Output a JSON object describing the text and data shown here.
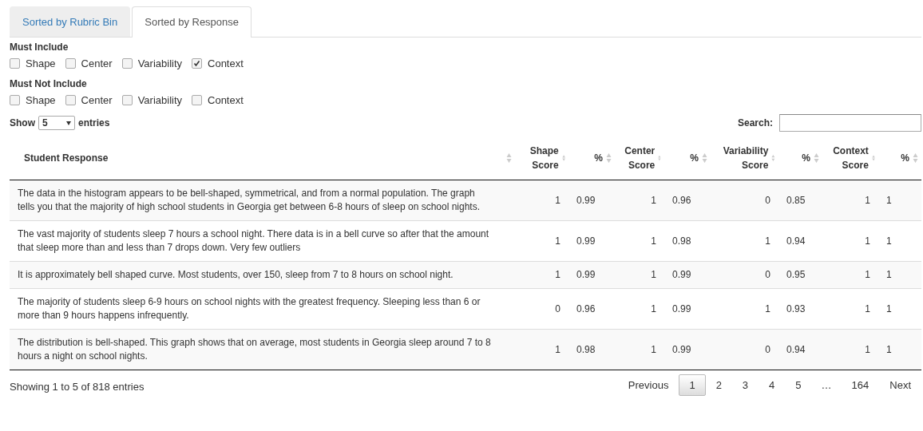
{
  "tabs": [
    {
      "label": "Sorted by Rubric Bin",
      "selected": false
    },
    {
      "label": "Sorted by Response",
      "selected": true
    }
  ],
  "filters": [
    {
      "title": "Must Include",
      "options": [
        {
          "label": "Shape",
          "checked": false
        },
        {
          "label": "Center",
          "checked": false
        },
        {
          "label": "Variability",
          "checked": false
        },
        {
          "label": "Context",
          "checked": true
        }
      ]
    },
    {
      "title": "Must Not Include",
      "options": [
        {
          "label": "Shape",
          "checked": false
        },
        {
          "label": "Center",
          "checked": false
        },
        {
          "label": "Variability",
          "checked": false
        },
        {
          "label": "Context",
          "checked": false
        }
      ]
    }
  ],
  "length_menu": {
    "label_before": "Show",
    "value": "5",
    "label_after": "entries"
  },
  "search": {
    "label": "Search:"
  },
  "table": {
    "columns": [
      {
        "label": "Student Response"
      },
      {
        "label": "Shape Score"
      },
      {
        "label": "%"
      },
      {
        "label": "Center Score"
      },
      {
        "label": "%"
      },
      {
        "label": "Variability Score"
      },
      {
        "label": "%"
      },
      {
        "label": "Context Score"
      },
      {
        "label": "%"
      }
    ],
    "rows": [
      {
        "cells": [
          "The data in the histogram appears to be bell-shaped, symmetrical, and from a normal population. The graph tells you that the majority of high school students in Georgia get between 6-8 hours of sleep on school nights.",
          "1",
          "0.99",
          "1",
          "0.96",
          "0",
          "0.85",
          "1",
          "1"
        ]
      },
      {
        "cells": [
          "The vast majority of students sleep 7 hours a school night. There data is in a bell curve so after that the amount that sleep more than and less than 7 drops down. Very few outliers",
          "1",
          "0.99",
          "1",
          "0.98",
          "1",
          "0.94",
          "1",
          "1"
        ]
      },
      {
        "cells": [
          "It is approximately bell shaped curve. Most students, over 150, sleep from 7 to 8 hours on school night.",
          "1",
          "0.99",
          "1",
          "0.99",
          "0",
          "0.95",
          "1",
          "1"
        ]
      },
      {
        "cells": [
          "The majority of students sleep 6-9 hours on school nights with the greatest frequency. Sleeping less than 6 or more than 9 hours happens infrequently.",
          "0",
          "0.96",
          "1",
          "0.99",
          "1",
          "0.93",
          "1",
          "1"
        ]
      },
      {
        "cells": [
          "The distribution is bell-shaped. This graph shows that on average, most students in Georgia sleep around 7 to 8 hours a night on school nights.",
          "1",
          "0.98",
          "1",
          "0.99",
          "0",
          "0.94",
          "1",
          "1"
        ]
      }
    ]
  },
  "info": "Showing 1 to 5 of 818 entries",
  "pagination": [
    {
      "kind": "nav",
      "label": "Previous",
      "selected": false
    },
    {
      "kind": "page",
      "label": "1",
      "selected": true
    },
    {
      "kind": "page",
      "label": "2",
      "selected": false
    },
    {
      "kind": "page",
      "label": "3",
      "selected": false
    },
    {
      "kind": "page",
      "label": "4",
      "selected": false
    },
    {
      "kind": "page",
      "label": "5",
      "selected": false
    },
    {
      "kind": "ellipsis",
      "label": "…"
    },
    {
      "kind": "page",
      "label": "164",
      "selected": false
    },
    {
      "kind": "nav",
      "label": "Next",
      "selected": false
    }
  ]
}
